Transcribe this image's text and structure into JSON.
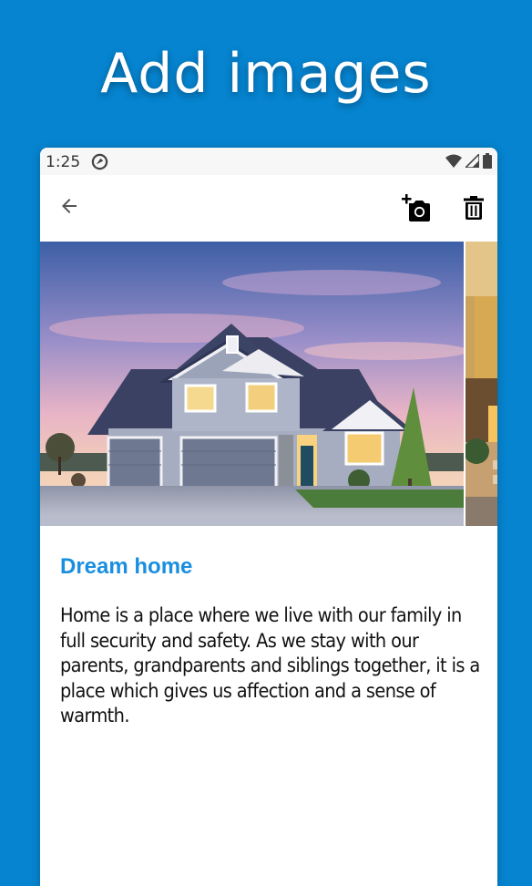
{
  "headline": "Add images",
  "status_bar": {
    "time": "1:25",
    "icons": [
      "app-notification-icon",
      "wifi-icon",
      "signal-icon",
      "battery-icon"
    ]
  },
  "toolbar": {
    "back_icon": "arrow-back-icon",
    "add_photo_icon": "add-photo-camera-icon",
    "delete_icon": "trash-icon"
  },
  "note": {
    "title": "Dream home",
    "body": "Home is a place where we live with our family in full security and safety. As we stay with our parents, grandparents and siblings together, it is a place which gives us affection and a sense of warmth."
  },
  "colors": {
    "background": "#0684d0",
    "title_accent": "#1a8fe0",
    "text": "#111111"
  }
}
